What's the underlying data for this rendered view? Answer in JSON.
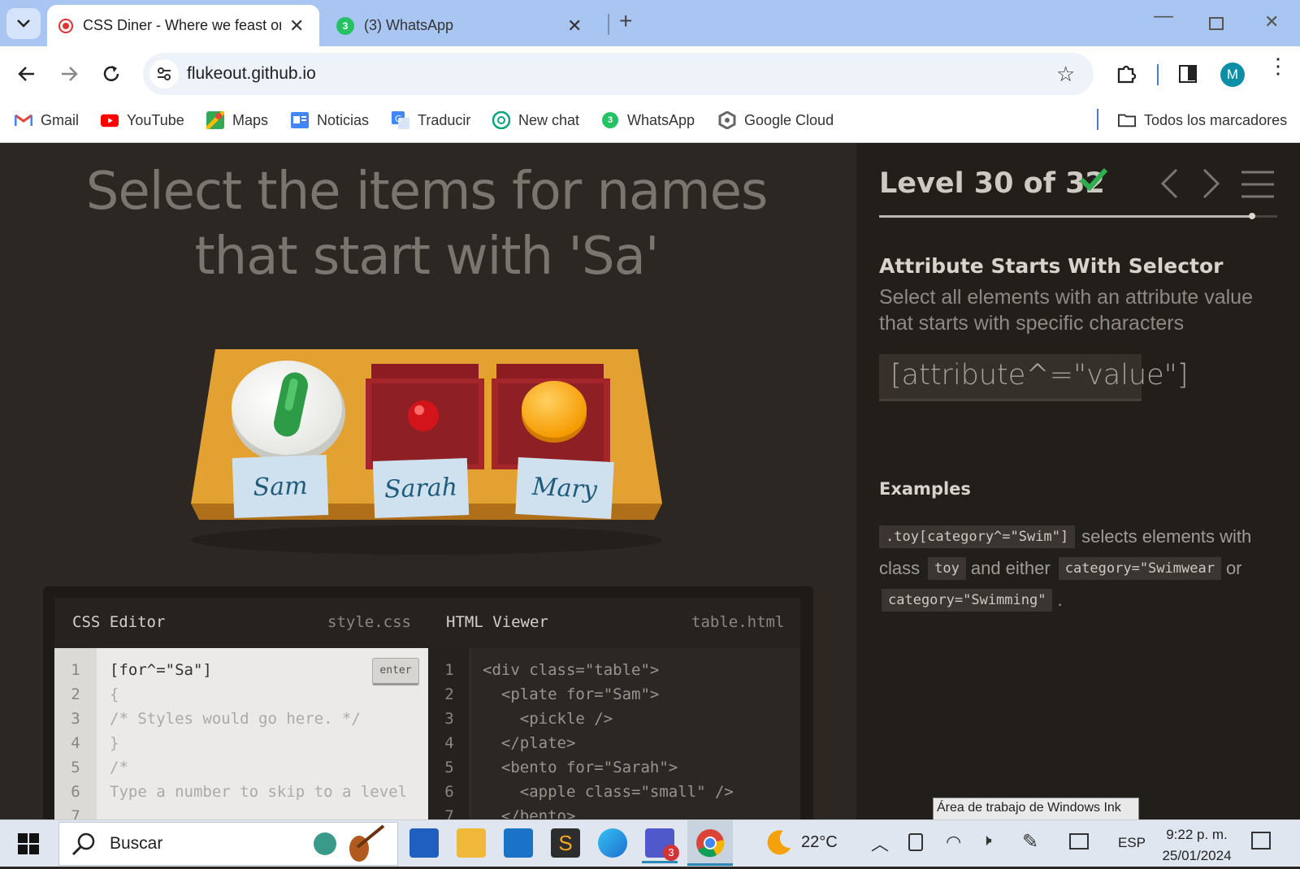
{
  "browser": {
    "tabs": [
      {
        "title": "CSS Diner - Where we feast on CSS Selectors!",
        "active": true
      },
      {
        "title": "(3) WhatsApp",
        "active": false
      }
    ],
    "new_tab_label": "+",
    "url": "flukeout.github.io",
    "profile_initial": "M",
    "bookmarks": [
      {
        "label": "Gmail",
        "icon": "gmail-icon"
      },
      {
        "label": "YouTube",
        "icon": "youtube-icon"
      },
      {
        "label": "Maps",
        "icon": "maps-icon"
      },
      {
        "label": "Noticias",
        "icon": "news-icon"
      },
      {
        "label": "Traducir",
        "icon": "translate-icon"
      },
      {
        "label": "New chat",
        "icon": "chatgpt-icon"
      },
      {
        "label": "WhatsApp",
        "icon": "whatsapp-icon"
      },
      {
        "label": "Google Cloud",
        "icon": "google-cloud-icon"
      }
    ],
    "all_bookmarks_label": "Todos los marcadores",
    "whatsapp_badge": "3"
  },
  "game": {
    "instruction": "Select the items for names that start with 'Sa'",
    "plates": [
      {
        "name": "Sam",
        "item": "pickle"
      },
      {
        "name": "Sarah",
        "item": "apple small"
      },
      {
        "name": "Mary",
        "item": "orange"
      }
    ],
    "level_label": "Level 30 of 32",
    "level_complete": true,
    "progress_fraction": 0.9375,
    "selector_title": "Attribute Starts With Selector",
    "selector_description": "Select all elements with an attribute value that starts with specific characters",
    "syntax": "[attribute^=\"value\"]",
    "examples_title": "Examples",
    "example": {
      "code1": ".toy[category^=\"Swim\"]",
      "text1": "selects elements with",
      "text2": "class",
      "code2": "toy",
      "text3": "and either",
      "code3": "category=\"Swimwear",
      "text4": "or",
      "code4": "category=\"Swimming\"",
      "text5": "."
    }
  },
  "editor": {
    "css_title": "CSS Editor",
    "css_file": "style.css",
    "html_title": "HTML Viewer",
    "html_file": "table.html",
    "enter_label": "enter",
    "css_lines": [
      {
        "n": "1",
        "text": "[for^=\"Sa\"]"
      },
      {
        "n": "2",
        "text": "{"
      },
      {
        "n": "3",
        "text": "/* Styles would go here. */"
      },
      {
        "n": "4",
        "text": "}"
      },
      {
        "n": "5",
        "text": ""
      },
      {
        "n": "6",
        "text": "/*"
      },
      {
        "n": "7",
        "text": "Type a number to skip to a level"
      }
    ],
    "html_lines": [
      {
        "n": "1",
        "text": "<div class=\"table\">"
      },
      {
        "n": "2",
        "text": "  <plate for=\"Sam\">"
      },
      {
        "n": "3",
        "text": "    <pickle />"
      },
      {
        "n": "4",
        "text": "  </plate>"
      },
      {
        "n": "5",
        "text": "  <bento for=\"Sarah\">"
      },
      {
        "n": "6",
        "text": "    <apple class=\"small\" />"
      },
      {
        "n": "7",
        "text": "  </bento>"
      }
    ]
  },
  "taskbar": {
    "search_placeholder": "Buscar",
    "tooltip": "Área de trabajo de Windows Ink",
    "temperature": "22°C",
    "language": "ESP",
    "time": "9:22 p. m.",
    "date": "25/01/2024",
    "teams_badge": "3"
  },
  "colors": {
    "accent_green": "#2e9b46",
    "board": "#e09d2f",
    "bento": "#9e2327"
  }
}
